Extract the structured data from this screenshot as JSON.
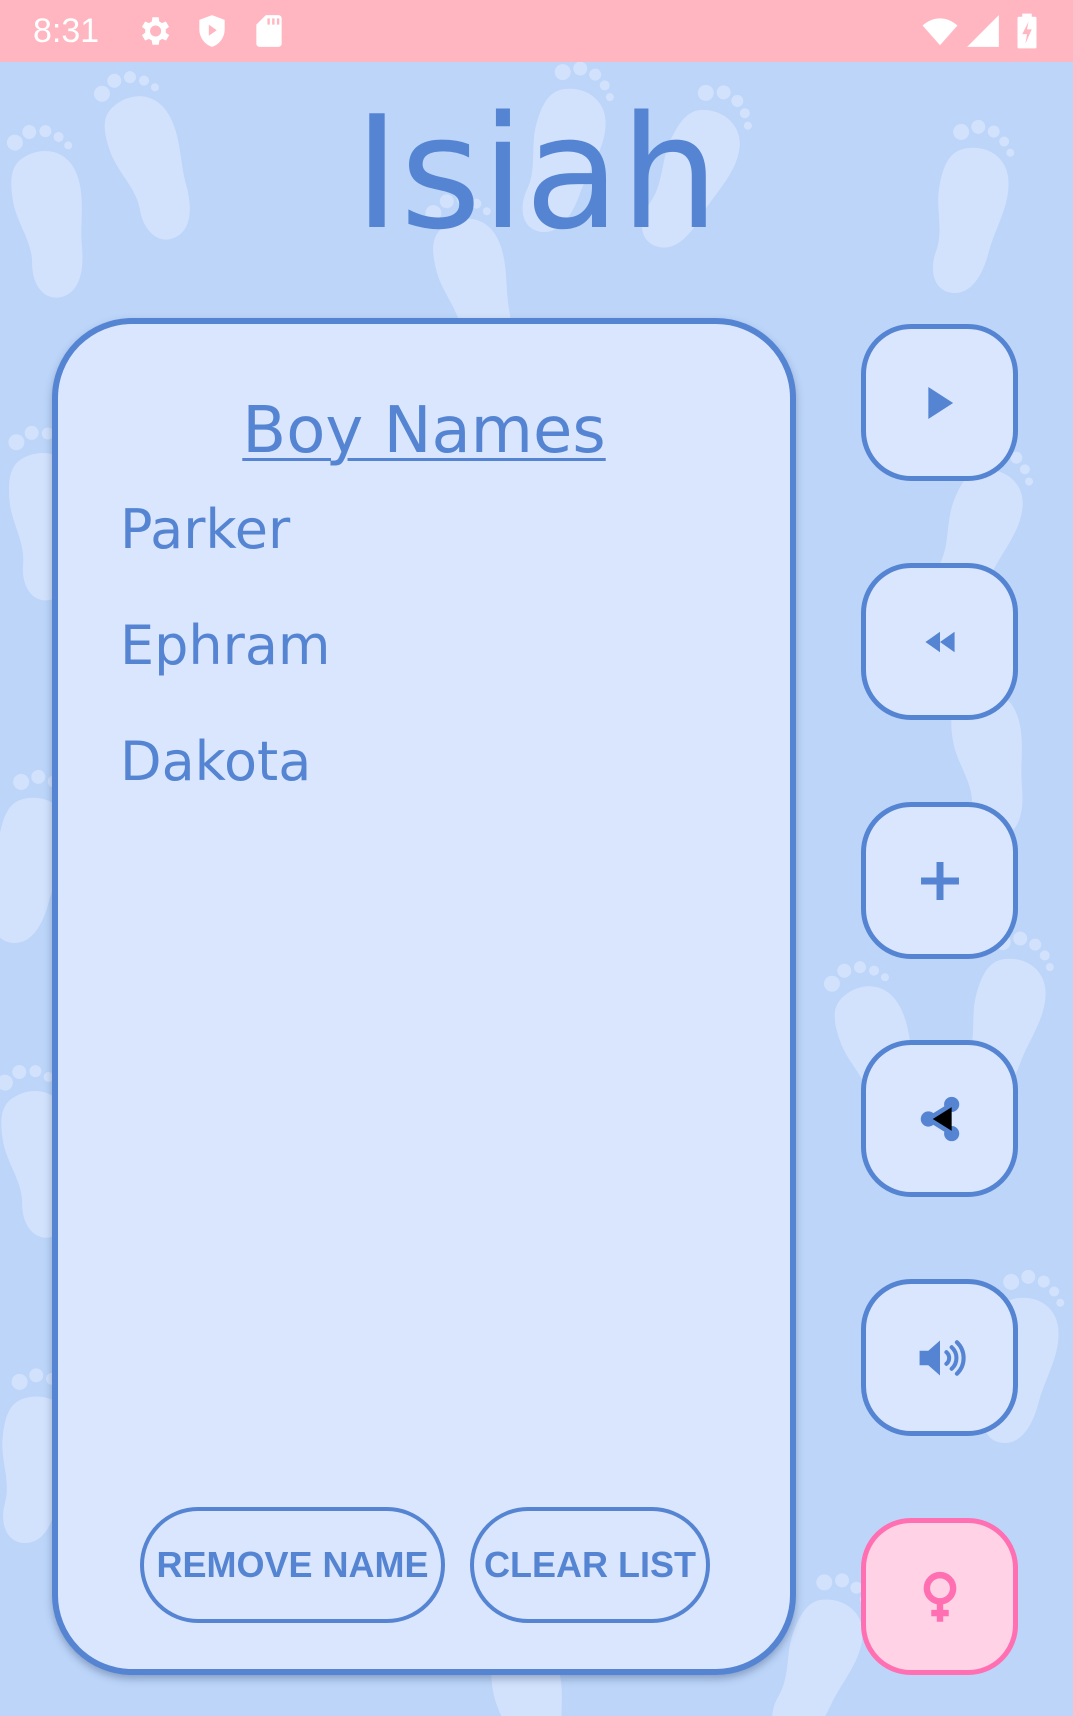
{
  "status_bar": {
    "time": "8:31",
    "icons": [
      "settings-icon",
      "shield-play-icon",
      "sd-card-icon",
      "wifi-icon",
      "signal-icon",
      "battery-charging-icon"
    ]
  },
  "baby_name": "Isiah",
  "list": {
    "title": "Boy Names",
    "names": [
      "Parker",
      "Ephram",
      "Dakota"
    ]
  },
  "buttons": {
    "remove_name": "REMOVE NAME",
    "clear_list": "CLEAR LIST"
  },
  "side_buttons": [
    "play-icon",
    "rewind-icon",
    "plus-icon",
    "share-icon",
    "volume-icon",
    "female-symbol-icon"
  ],
  "colors": {
    "accent": "#5585d2",
    "background": "#bcd5f9",
    "card": "#dae6fd",
    "status_bar": "#ffb6c0",
    "gender_accent": "#ff6fb1",
    "gender_fill": "#ffd2e5"
  }
}
